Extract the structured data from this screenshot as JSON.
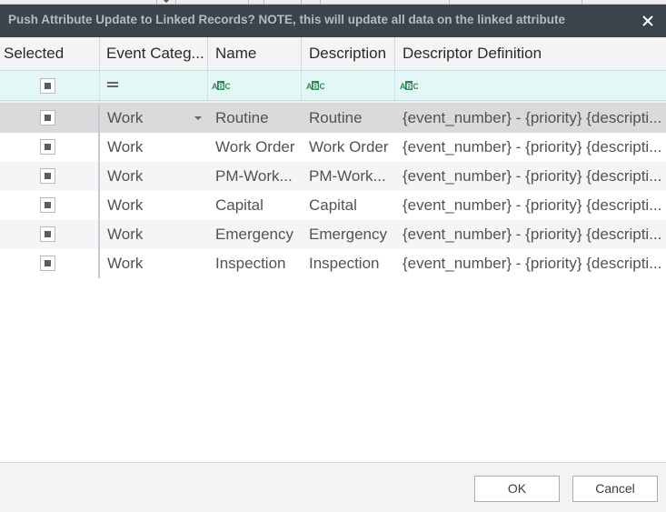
{
  "dialog": {
    "title": "Push Attribute Update to Linked Records? NOTE, this will update all data on the linked attribute"
  },
  "grid": {
    "columns": [
      "Selected",
      "Event Categ...",
      "Name",
      "Description",
      "Descriptor Definition"
    ],
    "filter_icons": [
      "equals-icon",
      "text-filter-icon",
      "text-filter-icon",
      "text-filter-icon"
    ],
    "rows": [
      {
        "category": "Work",
        "name": "Routine",
        "description": "Routine",
        "definition": "{event_number} - {priority}  {descripti..."
      },
      {
        "category": "Work",
        "name": "Work Order",
        "description": "Work Order",
        "definition": "{event_number} - {priority}  {descripti..."
      },
      {
        "category": "Work",
        "name": "PM-Work...",
        "description": "PM-Work...",
        "definition": "{event_number} - {priority}  {descripti..."
      },
      {
        "category": "Work",
        "name": "Capital",
        "description": "Capital",
        "definition": "{event_number} - {priority}  {descripti..."
      },
      {
        "category": "Work",
        "name": "Emergency",
        "description": "Emergency",
        "definition": "{event_number} - {priority}  {descripti..."
      },
      {
        "category": "Work",
        "name": "Inspection",
        "description": "Inspection",
        "definition": "{event_number} - {priority}  {descripti..."
      }
    ]
  },
  "footer": {
    "ok_label": "OK",
    "cancel_label": "Cancel"
  },
  "colors": {
    "titlebar": "#3b434b",
    "filter_row": "#e3f7f6",
    "selected_row": "#d9dadb",
    "abc_icon": "#2e8b57"
  }
}
